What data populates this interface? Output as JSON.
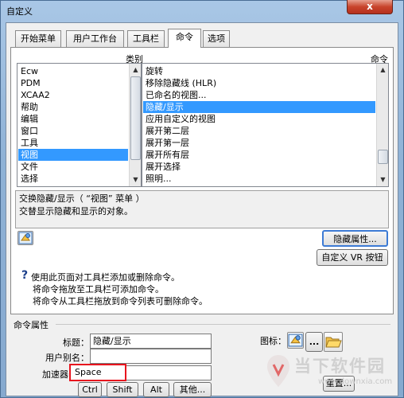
{
  "window": {
    "title": "自定义",
    "close_label": "x"
  },
  "tabs": [
    {
      "label": "开始菜单"
    },
    {
      "label": "用户工作台"
    },
    {
      "label": "工具栏"
    },
    {
      "label": "命令"
    },
    {
      "label": "选项"
    }
  ],
  "active_tab": "命令",
  "category": {
    "header": "类别",
    "items": [
      "Ecw",
      "PDM",
      "XCAA2",
      "帮助",
      "编辑",
      "窗口",
      "工具",
      "视图",
      "文件",
      "选择"
    ],
    "selected": "视图"
  },
  "commands": {
    "header": "命令",
    "items": [
      "旋转",
      "移除隐藏线 (HLR)",
      "已命名的视图...",
      "隐藏/显示",
      "应用自定义的视图",
      "展开第二层",
      "展开第一层",
      "展开所有层",
      "展开选择",
      "照明..."
    ],
    "selected": "隐藏/显示"
  },
  "description": {
    "line1": "交换隐藏/显示（ “视图” 菜单 ）",
    "line2": "交替显示隐藏和显示的对象。"
  },
  "buttons": {
    "hide_props": "隐藏属性...",
    "custom_vr": "自定义 VR 按钮",
    "ctrl": "Ctrl",
    "shift": "Shift",
    "alt": "Alt",
    "other": "其他...",
    "reset": "重置...",
    "ellipsis": "..."
  },
  "help": {
    "line1": "使用此页面对工具栏添加或删除命令。",
    "line2": "将命令拖放至工具栏可添加命令。",
    "line3": "将命令从工具栏拖放到命令列表可删除命令。"
  },
  "properties": {
    "section_label": "命令属性",
    "title_label": "标题：",
    "title_value": "隐藏/显示",
    "alias_label": "用户别名：",
    "alias_value": "",
    "accel_label": "加速器",
    "accel_value": "Space",
    "icon_label": "图标："
  },
  "watermark": {
    "brand": "当下软件园",
    "url": "www.downxia.com"
  },
  "colors": {
    "selection": "#3399ff",
    "highlight_box": "#e8141e"
  }
}
